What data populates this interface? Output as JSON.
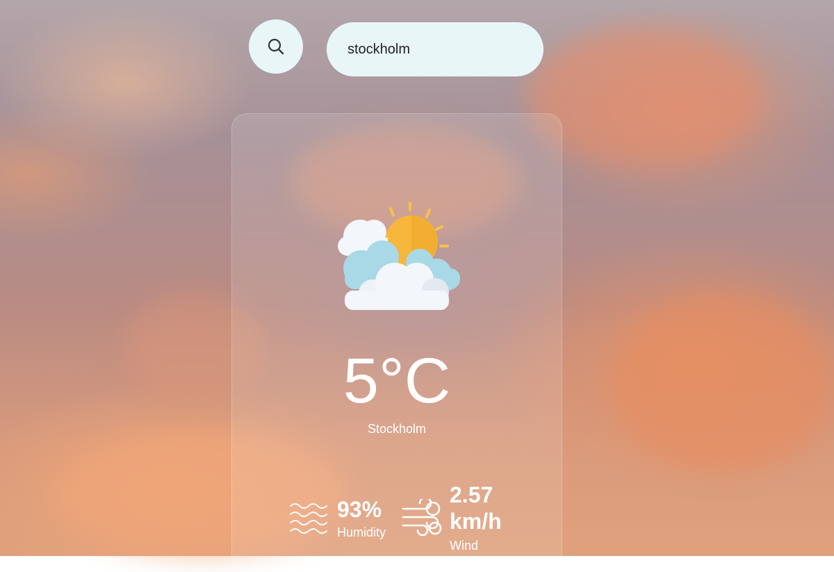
{
  "search": {
    "value": "stockholm",
    "icon": "search-icon"
  },
  "weather": {
    "icon": "partly-cloudy-sun-icon",
    "temperature": "5°C",
    "city": "Stockholm",
    "humidity": {
      "icon": "humidity-waves-icon",
      "value": "93%",
      "label": "Humidity"
    },
    "wind": {
      "icon": "wind-icon",
      "value": "2.57 km/h",
      "label": "Wind"
    }
  },
  "colors": {
    "search_bg": "#e8f6f8",
    "text": "#ffffff",
    "sun": "#f6b73c",
    "cloud_light": "#f3f6fa",
    "cloud_blue": "#a9d8e6"
  }
}
